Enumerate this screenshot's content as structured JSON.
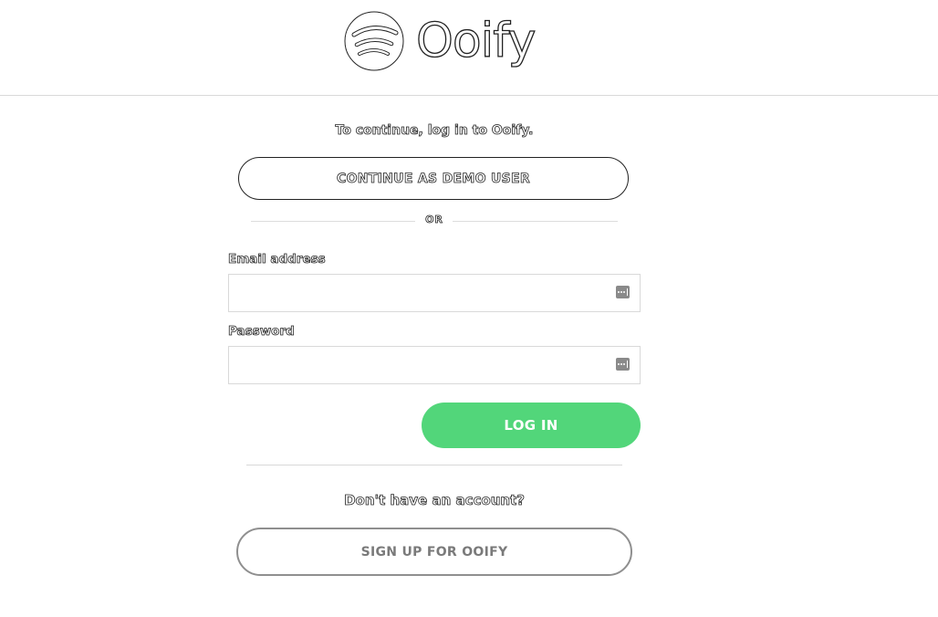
{
  "brand": {
    "name": "Ooify",
    "logo_icon": "ooify-logo-icon"
  },
  "login": {
    "prompt": "To continue, log in to Ooify.",
    "demo_button_label": "CONTINUE AS DEMO USER",
    "or_text": "OR",
    "email_label": "Email address",
    "email_value": "",
    "password_label": "Password",
    "password_value": "",
    "password_manager_icon": "password-manager-icon",
    "login_button_label": "LOG IN"
  },
  "signup": {
    "prompt": "Don't have an account?",
    "button_label": "SIGN UP FOR OOIFY"
  },
  "colors": {
    "login_button": "#52d67a",
    "signup_border": "#8f8f8f"
  }
}
